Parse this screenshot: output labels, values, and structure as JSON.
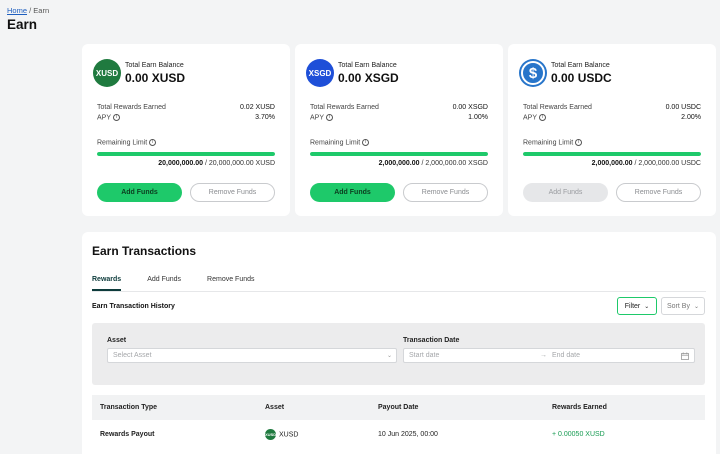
{
  "breadcrumb": {
    "home": "Home",
    "separator": "/",
    "current": "Earn"
  },
  "page_title": "Earn",
  "cards": [
    {
      "coin_icon": "xusd-coin-icon",
      "coin_text": "XUSD",
      "balance_label": "Total Earn Balance",
      "balance": "0.00 XUSD",
      "rewards_label": "Total Rewards Earned",
      "rewards_value": "0.02 XUSD",
      "apy_label": "APY",
      "apy_value": "3.70%",
      "limit_label": "Remaining Limit",
      "limit_remaining": "20,000,000.00",
      "limit_total": " / 20,000,000.00 XUSD",
      "limit_fill": 1.0,
      "add_label": "Add Funds",
      "remove_label": "Remove Funds",
      "add_enabled": true
    },
    {
      "coin_icon": "xsgd-coin-icon",
      "coin_text": "XSGD",
      "balance_label": "Total Earn Balance",
      "balance": "0.00 XSGD",
      "rewards_label": "Total Rewards Earned",
      "rewards_value": "0.00 XSGD",
      "apy_label": "APY",
      "apy_value": "1.00%",
      "limit_label": "Remaining Limit",
      "limit_remaining": "2,000,000.00",
      "limit_total": " / 2,000,000.00 XSGD",
      "limit_fill": 1.0,
      "add_label": "Add Funds",
      "remove_label": "Remove Funds",
      "add_enabled": true
    },
    {
      "coin_icon": "usdc-coin-icon",
      "coin_text": "$",
      "balance_label": "Total Earn Balance",
      "balance": "0.00 USDC",
      "rewards_label": "Total Rewards Earned",
      "rewards_value": "0.00 USDC",
      "apy_label": "APY",
      "apy_value": "2.00%",
      "limit_label": "Remaining Limit",
      "limit_remaining": "2,000,000.00",
      "limit_total": " / 2,000,000.00 USDC",
      "limit_fill": 1.0,
      "add_label": "Add Funds",
      "remove_label": "Remove Funds",
      "add_enabled": false
    }
  ],
  "transactions": {
    "title": "Earn Transactions",
    "tabs": [
      "Rewards",
      "Add Funds",
      "Remove Funds"
    ],
    "active_tab": "Rewards",
    "history_title": "Earn Transaction History",
    "filter_label": "Filter",
    "sort_label": "Sort By",
    "asset_label": "Asset",
    "asset_placeholder": "Select Asset",
    "date_label": "Transaction Date",
    "start_placeholder": "Start date",
    "date_arrow": "→",
    "end_placeholder": "End date",
    "columns": [
      "Transaction Type",
      "Asset",
      "Payout Date",
      "Rewards Earned"
    ],
    "rows": [
      {
        "type": "Rewards Payout",
        "asset_icon_text": "XUSD",
        "asset": "XUSD",
        "date": "10 Jun 2025, 00:00",
        "reward": "+ 0.00050 XUSD"
      }
    ]
  },
  "colors": {
    "accent": "#1ec96a",
    "reward_text": "#179b52",
    "tab_active": "#0d3b3b"
  }
}
